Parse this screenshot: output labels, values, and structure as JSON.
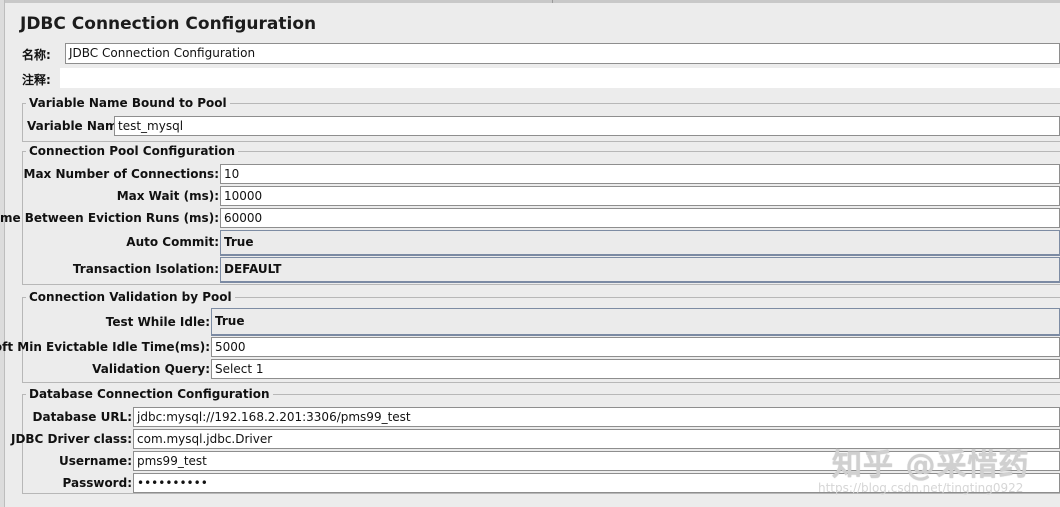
{
  "panel": {
    "title": "JDBC Connection Configuration"
  },
  "name_row": {
    "label": "名称:",
    "value": "JDBC Connection Configuration"
  },
  "comment_row": {
    "label": "注释:",
    "value": ""
  },
  "variable_group": {
    "title": "Variable Name Bound to Pool",
    "variable_name": {
      "label": "Variable Name:",
      "value": "test_mysql"
    }
  },
  "pool_group": {
    "title": "Connection Pool Configuration",
    "max_connections": {
      "label": "Max Number of Connections:",
      "value": "10"
    },
    "max_wait": {
      "label": "Max Wait (ms):",
      "value": "10000"
    },
    "eviction_runs": {
      "label": "Time Between Eviction Runs (ms):",
      "value": "60000"
    },
    "auto_commit": {
      "label": "Auto Commit:",
      "value": "True"
    },
    "transaction_isolation": {
      "label": "Transaction Isolation:",
      "value": "DEFAULT"
    }
  },
  "validation_group": {
    "title": "Connection Validation by Pool",
    "test_while_idle": {
      "label": "Test While Idle:",
      "value": "True"
    },
    "soft_min_idle": {
      "label": "Soft Min Evictable Idle Time(ms):",
      "value": "5000"
    },
    "validation_query": {
      "label": "Validation Query:",
      "value": "Select 1"
    }
  },
  "database_group": {
    "title": "Database Connection Configuration",
    "database_url": {
      "label": "Database URL:",
      "value": "jdbc:mysql://192.168.2.201:3306/pms99_test"
    },
    "driver_class": {
      "label": "JDBC Driver class:",
      "value": "com.mysql.jdbc.Driver"
    },
    "username": {
      "label": "Username:",
      "value": "pms99_test"
    },
    "password": {
      "label": "Password:",
      "value": "••••••••••"
    }
  },
  "watermark": {
    "text": "知乎 @采惜药",
    "url": "https://blog.csdn.net/tingting0922"
  }
}
